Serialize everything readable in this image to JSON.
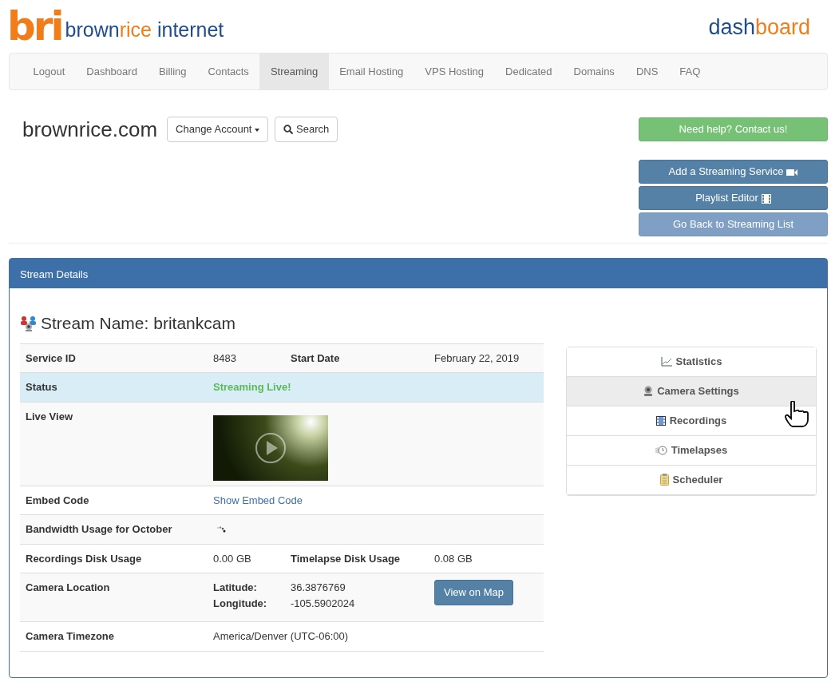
{
  "logo": {
    "mark": "bri",
    "name_parts": [
      "brown",
      "rice",
      " internet"
    ]
  },
  "header_title": {
    "first": "dash",
    "second": "board"
  },
  "nav": [
    {
      "label": "Logout",
      "selected": false
    },
    {
      "label": "Dashboard",
      "selected": false
    },
    {
      "label": "Billing",
      "selected": false
    },
    {
      "label": "Contacts",
      "selected": false
    },
    {
      "label": "Streaming",
      "selected": true
    },
    {
      "label": "Email Hosting",
      "selected": false
    },
    {
      "label": "VPS Hosting",
      "selected": false
    },
    {
      "label": "Dedicated",
      "selected": false
    },
    {
      "label": "Domains",
      "selected": false
    },
    {
      "label": "DNS",
      "selected": false
    },
    {
      "label": "FAQ",
      "selected": false
    }
  ],
  "account": {
    "name": "brownrice.com",
    "change_button": "Change Account",
    "search_button": "Search"
  },
  "action_buttons": [
    {
      "label": "Need help? Contact us!",
      "kind": "success"
    },
    {
      "label": "Add a Streaming Service",
      "kind": "primary"
    },
    {
      "label": "Playlist Editor",
      "kind": "primary"
    },
    {
      "label": "Go Back to Streaming List",
      "kind": "muted"
    }
  ],
  "panel": {
    "title": "Stream Details",
    "stream_title": "Stream Name: britankcam",
    "rows": [
      {
        "kind": "text",
        "label": "Service ID",
        "value": "8483",
        "label2": "Start Date",
        "value2": "February 22, 2019"
      },
      {
        "kind": "status",
        "label": "Status",
        "value": "Streaming Live!"
      },
      {
        "kind": "video",
        "label": "Live View"
      },
      {
        "kind": "link",
        "label": "Embed Code",
        "value": "Show Embed Code"
      },
      {
        "kind": "loading",
        "label": "Bandwidth Usage for October"
      },
      {
        "kind": "text",
        "label": "Recordings Disk Usage",
        "value": "0.00 GB",
        "label2": "Timelapse Disk Usage",
        "value2": "0.08 GB"
      },
      {
        "kind": "location",
        "label": "Camera Location",
        "lat_label": "Latitude:",
        "lat": "36.3876769",
        "lon_label": "Longitude:",
        "lon": "-105.5902024",
        "button": "View on Map"
      },
      {
        "kind": "text",
        "label": "Camera Timezone",
        "value": "America/Denver (UTC-06:00)"
      }
    ],
    "menu": [
      {
        "label": "Statistics",
        "selected": false
      },
      {
        "label": "Camera Settings",
        "selected": true
      },
      {
        "label": "Recordings",
        "selected": false
      },
      {
        "label": "Timelapses",
        "selected": false
      },
      {
        "label": "Scheduler",
        "selected": false
      }
    ]
  }
}
